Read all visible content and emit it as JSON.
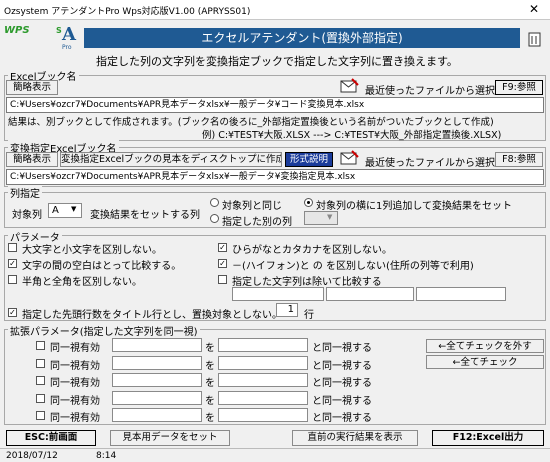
{
  "window": {
    "title": "Ozsystem アテンダントPro Wps対応版V1.00 (APRYSS01)",
    "close_glyph": "✕"
  },
  "logo": {
    "wps": "WPS",
    "app_letter": "A",
    "app_tag": "S",
    "app_sub": "Pro"
  },
  "banner": {
    "title": "エクセルアテンダント(置換外部指定)",
    "color": "#1f5a93"
  },
  "description": "指定した列の文字列を変換指定ブックで指定した文字列に置き換えます。",
  "excel_book": {
    "group_label": "Excelブック名",
    "brief_button": "簡略表示",
    "recent_label": "最近使ったファイルから選択",
    "browse_button": "F9:参照",
    "path": "C:¥Users¥ozcr7¥Documents¥APR見本データxlsx¥一般データ¥コード変換見本.xlsx",
    "note1": "結果は、別ブックとして作成されます。(ブック名の後ろに_外部指定置換後という名前がついたブックとして作成)",
    "note2": "例) C:¥TEST¥大阪.XLSX ---> C:¥TEST¥大阪_外部指定置換後.XLSX)"
  },
  "convert_book": {
    "group_label": "変換指定Excelブック名",
    "brief_button": "簡略表示",
    "create_sample_button": "変換指定Excelブックの見本をディスクトップに作成",
    "format_button": "形式説明",
    "recent_label": "最近使ったファイルから選択",
    "browse_button": "F8:参照",
    "path": "C:¥Users¥ozcr7¥Documents¥APR見本データxlsx¥一般データ¥変換指定見本.xlsx"
  },
  "column_spec": {
    "group_label": "列指定",
    "target_label": "対象列",
    "target_value": "A",
    "result_label": "変換結果をセットする列",
    "options": [
      "対象列と同じ",
      "対象列の横に1列追加して変換結果をセット",
      "指定した別の列"
    ],
    "selected": 1
  },
  "params": {
    "group_label": "パラメータ",
    "case": "大文字と小文字を区別しない。",
    "space": "文字の間の空白はとって比較する。",
    "width": "半角と全角を区別しない。",
    "kana": "ひらがなとカタカナを区別しない。",
    "hyphen": "－(ハイフォン)と の を区別しない(住所の列等で利用)",
    "exclude": "指定した文字列は除いて比較する",
    "header_rows": "指定した先頭行数をタイトル行とし、置換対象としない。",
    "header_rows_value": "1",
    "header_rows_unit": "行",
    "checked": {
      "case": false,
      "space": true,
      "width": false,
      "kana": true,
      "hyphen": true,
      "exclude": false,
      "header_rows": true
    }
  },
  "extended": {
    "group_label": "拡張パラメータ(指定した文字列を同一視)",
    "row_label": "同一視有効",
    "wo": "を",
    "same": "と同一視する",
    "rows": 5,
    "uncheck_all": "←全てチェックを外す",
    "check_all": "←全てチェック"
  },
  "footer": {
    "back": "ESC:前画面",
    "sample": "見本用データをセット",
    "prev_result": "直前の実行結果を表示",
    "run": "F12:Excel出力"
  },
  "status": {
    "date": "2018/07/12",
    "time": "8:14"
  }
}
